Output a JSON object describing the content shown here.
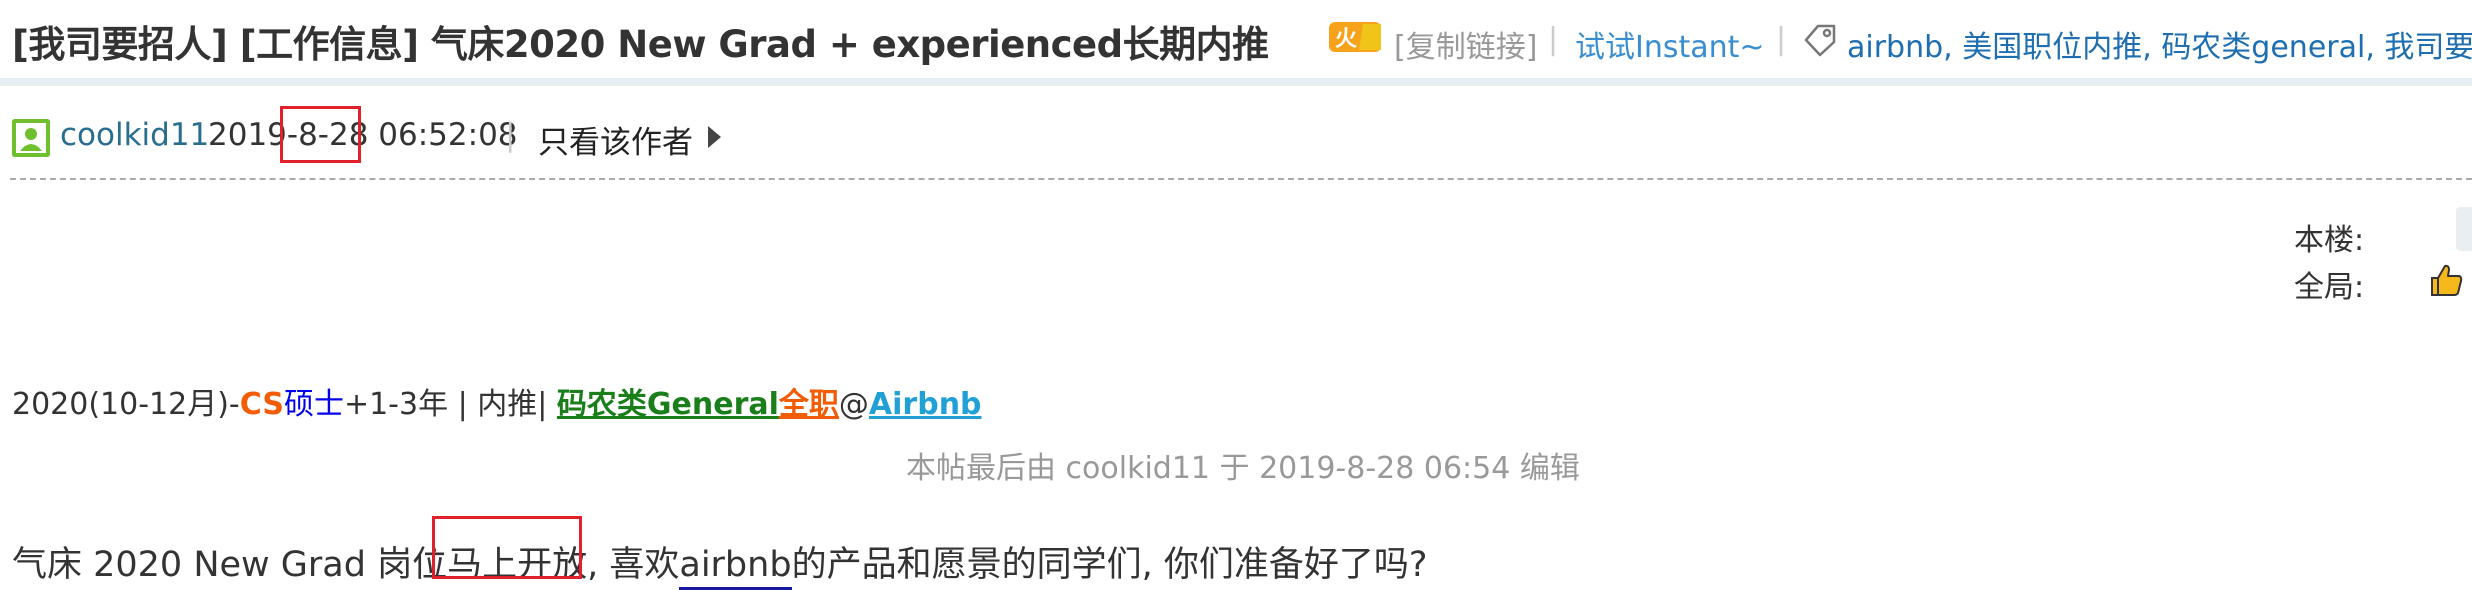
{
  "header": {
    "title": "[我司要招人] [工作信息] 气床2020 New Grad + experienced长期内推",
    "hot_badge_text": "火",
    "copy_link": "[复制链接]",
    "separator": "|",
    "instant_link": "试试Instant~",
    "tags": [
      "airbnb",
      "美国职位内推",
      "码农类general",
      "我司要招"
    ]
  },
  "post": {
    "author": "coolkid11",
    "timestamp": "2019-8-28 06:52:08",
    "only_author": "只看该作者",
    "floor_label": "本楼:",
    "global_label": "全局:",
    "classification": {
      "prefix": "2020(10-12月)-",
      "degree_cs": "CS",
      "degree_rest": "硕士",
      "experience": "+1-3年 | 内推| ",
      "job_type": "码农类General",
      "fulltime": "全职",
      "at": "@",
      "company": "Airbnb"
    },
    "edit_note": "本帖最后由 coolkid11 于 2019-8-28 06:54 编辑",
    "body_before": "气床 2020 New Grad 岗位",
    "body_highlight": "马上开放,",
    "body_middle": " 喜欢",
    "body_link": "airbnb",
    "body_after": "的产品和愿景的同学们, 你们准备好了吗?"
  },
  "colors": {
    "highlight_box": "#e0212b",
    "link_blue": "#1f6fb0",
    "author_teal": "#2a6e8f",
    "job_green": "#1a7f1a",
    "fulltime_orange": "#f25c05",
    "company_blue": "#21a0d6"
  },
  "icons": [
    "hot-badge-icon",
    "tag-icon",
    "avatar-icon",
    "arrow-right-icon",
    "thumbs-up-icon"
  ]
}
